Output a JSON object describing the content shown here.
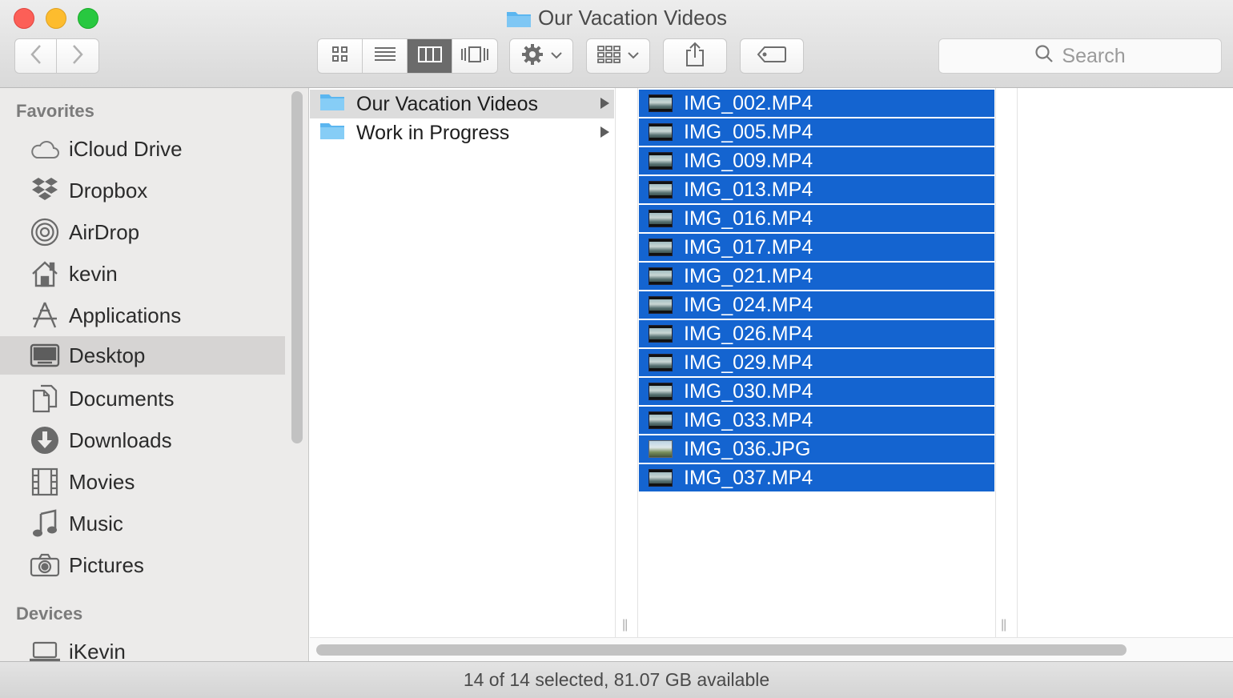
{
  "window": {
    "title": "Our Vacation Videos"
  },
  "toolbar": {
    "search_placeholder": "Search"
  },
  "sidebar": {
    "favorites_heading": "Favorites",
    "favorites": [
      {
        "label": "iCloud Drive",
        "icon": "cloud-icon"
      },
      {
        "label": "Dropbox",
        "icon": "dropbox-icon"
      },
      {
        "label": "AirDrop",
        "icon": "airdrop-icon"
      },
      {
        "label": "kevin",
        "icon": "home-icon"
      },
      {
        "label": "Applications",
        "icon": "applications-icon"
      },
      {
        "label": "Desktop",
        "icon": "desktop-icon",
        "selected": true
      },
      {
        "label": "Documents",
        "icon": "documents-icon"
      },
      {
        "label": "Downloads",
        "icon": "downloads-icon"
      },
      {
        "label": "Movies",
        "icon": "movies-icon"
      },
      {
        "label": "Music",
        "icon": "music-icon"
      },
      {
        "label": "Pictures",
        "icon": "pictures-icon"
      }
    ],
    "devices_heading": "Devices",
    "devices": [
      {
        "label": "iKevin",
        "icon": "laptop-icon"
      }
    ]
  },
  "columns": {
    "desktop_folders": [
      {
        "label": "Our Vacation Videos",
        "selected": true
      },
      {
        "label": "Work in Progress",
        "selected": false
      }
    ],
    "files": [
      {
        "name": "IMG_002.MP4",
        "type": "video"
      },
      {
        "name": "IMG_005.MP4",
        "type": "video"
      },
      {
        "name": "IMG_009.MP4",
        "type": "video"
      },
      {
        "name": "IMG_013.MP4",
        "type": "video"
      },
      {
        "name": "IMG_016.MP4",
        "type": "video"
      },
      {
        "name": "IMG_017.MP4",
        "type": "video"
      },
      {
        "name": "IMG_021.MP4",
        "type": "video"
      },
      {
        "name": "IMG_024.MP4",
        "type": "video"
      },
      {
        "name": "IMG_026.MP4",
        "type": "video"
      },
      {
        "name": "IMG_029.MP4",
        "type": "video"
      },
      {
        "name": "IMG_030.MP4",
        "type": "video"
      },
      {
        "name": "IMG_033.MP4",
        "type": "video"
      },
      {
        "name": "IMG_036.JPG",
        "type": "image"
      },
      {
        "name": "IMG_037.MP4",
        "type": "video"
      }
    ]
  },
  "status": {
    "text": "14 of 14 selected, 81.07 GB available"
  },
  "colors": {
    "selection": "#1464d0",
    "folder": "#5bb6f0"
  }
}
